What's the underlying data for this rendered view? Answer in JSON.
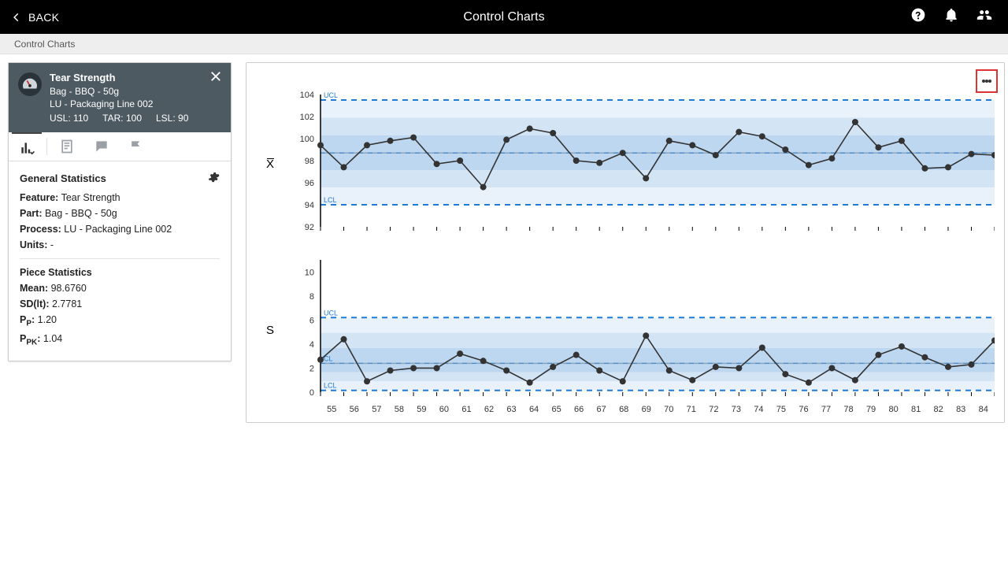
{
  "header": {
    "back": "BACK",
    "title": "Control Charts"
  },
  "breadcrumb": "Control Charts",
  "side": {
    "title": "Tear Strength",
    "part": "Bag - BBQ - 50g",
    "process": "LU - Packaging Line 002",
    "usl_label": "USL:",
    "usl": "110",
    "tar_label": "TAR:",
    "tar": "100",
    "lsl_label": "LSL:",
    "lsl": "90",
    "gen_h": "General Statistics",
    "feature_l": "Feature:",
    "feature_v": "Tear Strength",
    "part_l": "Part:",
    "part_v": "Bag - BBQ - 50g",
    "process_l": "Process:",
    "process_v": "LU - Packaging Line 002",
    "units_l": "Units:",
    "units_v": "-",
    "piece_h": "Piece Statistics",
    "mean_l": "Mean:",
    "mean_v": "98.6760",
    "sd_l": "SD(lt):",
    "sd_v": "2.7781",
    "pp_l": "P",
    "pp_sub": "P",
    "pp_colon": ":",
    "pp_v": "1.20",
    "ppk_l": "P",
    "ppk_sub": "PK",
    "ppk_colon": ":",
    "ppk_v": "1.04"
  },
  "chart_data": [
    {
      "type": "line",
      "name": "Xbar",
      "ylabel": "X̄",
      "x": [
        55,
        56,
        57,
        58,
        59,
        60,
        61,
        62,
        63,
        64,
        65,
        66,
        67,
        68,
        69,
        70,
        71,
        72,
        73,
        74,
        75,
        76,
        77,
        78,
        79,
        80,
        81,
        82,
        83,
        84
      ],
      "values": [
        99.4,
        97.4,
        99.4,
        99.8,
        100.1,
        97.7,
        98.0,
        95.6,
        99.9,
        100.9,
        100.5,
        98.0,
        97.8,
        98.7,
        96.4,
        99.8,
        99.4,
        98.5,
        100.6,
        100.2,
        99.0,
        97.6,
        98.2,
        101.5,
        99.2,
        99.8,
        97.3,
        97.4,
        98.6,
        98.5
      ],
      "ylim": [
        92,
        104
      ],
      "yticks": [
        92,
        94,
        96,
        98,
        100,
        102,
        104
      ],
      "ucl": 103.5,
      "lcl": 94.0,
      "cl": 98.7,
      "ucl_label": "UCL",
      "lcl_label": "LCL"
    },
    {
      "type": "line",
      "name": "S",
      "ylabel": "S",
      "x": [
        55,
        56,
        57,
        58,
        59,
        60,
        61,
        62,
        63,
        64,
        65,
        66,
        67,
        68,
        69,
        70,
        71,
        72,
        73,
        74,
        75,
        76,
        77,
        78,
        79,
        80,
        81,
        82,
        83,
        84
      ],
      "values": [
        2.7,
        4.4,
        0.9,
        1.8,
        2.0,
        2.0,
        3.2,
        2.6,
        1.8,
        0.8,
        2.1,
        3.1,
        1.8,
        0.9,
        4.7,
        1.8,
        1.0,
        2.1,
        2.0,
        3.7,
        1.5,
        0.8,
        2.0,
        1.0,
        3.1,
        3.8,
        2.9,
        2.1,
        2.3,
        4.3
      ],
      "ylim": [
        0,
        11
      ],
      "yticks": [
        0,
        2,
        4,
        6,
        8,
        10
      ],
      "ucl": 6.2,
      "lcl": 0.15,
      "cl": 2.4,
      "ucl_label": "UCL",
      "cl_label": "CL",
      "lcl_label": "LCL"
    }
  ]
}
